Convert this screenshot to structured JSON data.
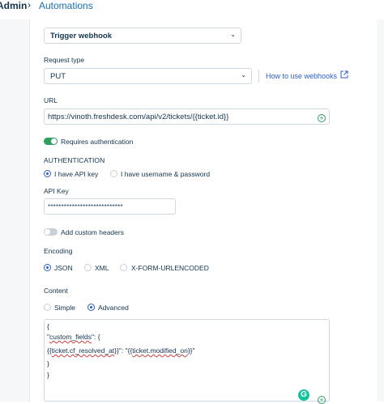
{
  "breadcrumb": {
    "root": "Admin",
    "separator": "›",
    "current": "Automations"
  },
  "action": {
    "selected": "Trigger webhook"
  },
  "request_type": {
    "label": "Request type",
    "selected": "PUT",
    "help_link": "How to use webhooks",
    "external_icon": "external-link-icon"
  },
  "url": {
    "label": "URL",
    "value": "https://vinoth.freshdesk.com/api/v2/tickets/{{ticket.id}}"
  },
  "requires_auth": {
    "label": "Requires authentication",
    "on": true
  },
  "authentication": {
    "heading": "AUTHENTICATION",
    "options": [
      "I have API key",
      "I have username & password"
    ],
    "selected": "I have API key"
  },
  "api_key": {
    "label": "API Key",
    "value": "****************************"
  },
  "custom_headers": {
    "label": "Add custom headers",
    "on": false
  },
  "encoding": {
    "label": "Encoding",
    "options": [
      "JSON",
      "XML",
      "X-FORM-URLENCODED"
    ],
    "selected": "JSON"
  },
  "content": {
    "label": "Content",
    "options": [
      "Simple",
      "Advanced"
    ],
    "selected": "Advanced",
    "lines": {
      "l1": "{",
      "l2a": "\"",
      "l2b": "custom_fields",
      "l2c": "\": {",
      "l3a": "{{",
      "l3b": "ticket.cf_resolved_at",
      "l3c": "}}\": \"{{",
      "l3d": "ticket.modified_on",
      "l3e": "}}\"",
      "l4": "}",
      "l5": "}"
    }
  },
  "colors": {
    "link": "#2c5cc5",
    "toggle_on": "#2f9e5f",
    "text": "#12344d",
    "grammarly": "#15c39a"
  }
}
